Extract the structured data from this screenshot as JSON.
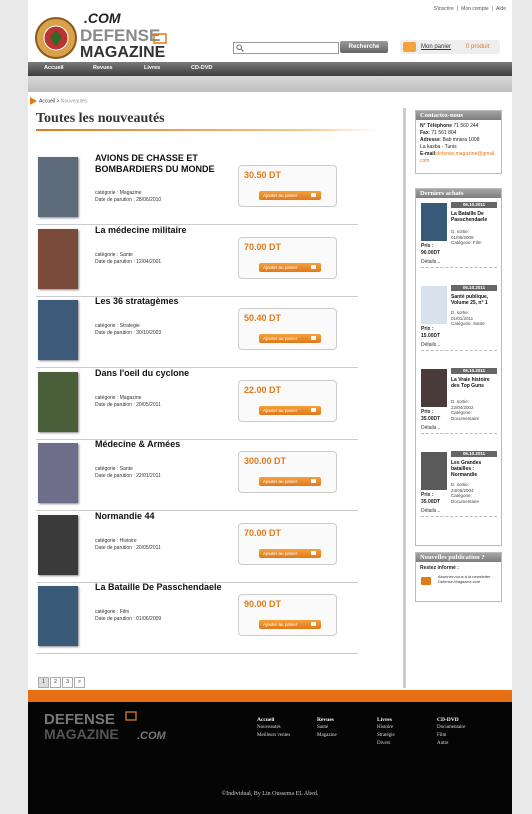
{
  "header": {
    "top_links": [
      "S'inscrire",
      "Mon compte",
      "Aide"
    ],
    "logo_com": ".COM",
    "logo_defense": "DEFENSE",
    "logo_magazine": "MAGAZINE",
    "search_placeholder": "",
    "search_button": "Recherche",
    "cart_label": "Mon panier",
    "cart_count": "0 produit"
  },
  "nav": {
    "items": [
      "Accueil",
      "Revues",
      "Livres",
      "CD-DVD"
    ]
  },
  "breadcrumb": {
    "home": "Accueil",
    "separator": " > ",
    "current": "Nouveautés"
  },
  "main": {
    "title": "Toutes les nouveautés",
    "add_to_cart_label": "Ajouter au panier",
    "category_prefix": "catégorie : ",
    "date_prefix": "Date de parution : ",
    "products": [
      {
        "name": "AVIONS DE CHASSE ET BOMBARDIERS DU MONDE",
        "category": "Magazine",
        "date": "28/06/2010",
        "price": "30.50 DT"
      },
      {
        "name": "La médecine militaire",
        "category": "Sante",
        "date": "12/04/2001",
        "price": "70.00 DT"
      },
      {
        "name": "Les 36 stratagèmes",
        "category": "Strategie",
        "date": "30/10/2003",
        "price": "50.40 DT"
      },
      {
        "name": "Dans l'oeil du cyclone",
        "category": "Magazine",
        "date": "20/05/2011",
        "price": "22.00 DT"
      },
      {
        "name": "Médecine & Armées",
        "category": "Sante",
        "date": "22/01/2011",
        "price": "300.00 DT"
      },
      {
        "name": "Normandie 44",
        "category": "Histoire",
        "date": "20/05/2011",
        "price": "70.00 DT"
      },
      {
        "name": "La Bataille De Passchendaele",
        "category": "Film",
        "date": "01/06/2009",
        "price": "90.00 DT"
      }
    ],
    "pager": [
      "1",
      "2",
      "3",
      ">"
    ]
  },
  "sidebar": {
    "contact": {
      "title": "Contactez-nous",
      "phone_label": "N° Téléphone",
      "phone": " 71 560 244",
      "fax_label": "Fax",
      "fax": " 71 561 804",
      "address_label": "Adresse",
      "address": " Bab mnara 1008",
      "city": "La kasba - Tunis",
      "email_label": "E-mail",
      "email": "defense.magazine@gmail.com"
    },
    "purchases": {
      "title": "Derniers achats",
      "price_label": "Prix :",
      "details_label": "Détails...",
      "items": [
        {
          "date": "06.10.2011",
          "title": "La Bataille De Passchendaele",
          "release_label": "D. sortie:",
          "release": "01/06/2009",
          "category_label": "Catégorie:",
          "category": "Film",
          "price": "90.00DT"
        },
        {
          "date": "06.10.2011",
          "title": "Santé publique, Volume 25, n° 1",
          "release_label": "D. sortie:",
          "release": "01/01/2011",
          "category_label": "Catégorie:",
          "category": "Sante",
          "price": "15.00DT"
        },
        {
          "date": "06.10.2011",
          "title": "La Vraie histoire des Top Guns",
          "release_label": "D. sortie:",
          "release": "22/04/2002",
          "category_label": "Catégorie:",
          "category": "Documentaire",
          "price": "35.00DT"
        },
        {
          "date": "06.10.2011",
          "title": "Les Grandes batailles : Normandie",
          "release_label": "D. sortie:",
          "release": "24/05/2004",
          "category_label": "Catégorie:",
          "category": "Documentaire",
          "price": "35.00DT"
        }
      ]
    },
    "newsletter": {
      "title": "Nouvelles publication ?",
      "subtitle": "Restez informé :",
      "text": "Abonnez-vous à la newsletter Defense-Magazine.com"
    }
  },
  "footer": {
    "logo_defense": "DEFENSE",
    "logo_magazine": "MAGAZINE",
    "logo_com": ".COM",
    "columns": [
      {
        "title": "Accueil",
        "links": [
          "Nouveautés",
          "Meilleurs ventes"
        ]
      },
      {
        "title": "Revues",
        "links": [
          "Santé",
          "Magazine"
        ]
      },
      {
        "title": "Livres",
        "links": [
          "Histoire",
          "Stratégie",
          "Divers"
        ]
      },
      {
        "title": "CD-DVD",
        "links": [
          "Documentaire",
          "Film",
          "Autre"
        ]
      }
    ],
    "copyright": "©Individual, By Lin Oussema EL Abed."
  },
  "colors": {
    "accent": "#e07a1c",
    "footer_bg": "#050505",
    "nav_bg": "#4a4a4a"
  }
}
